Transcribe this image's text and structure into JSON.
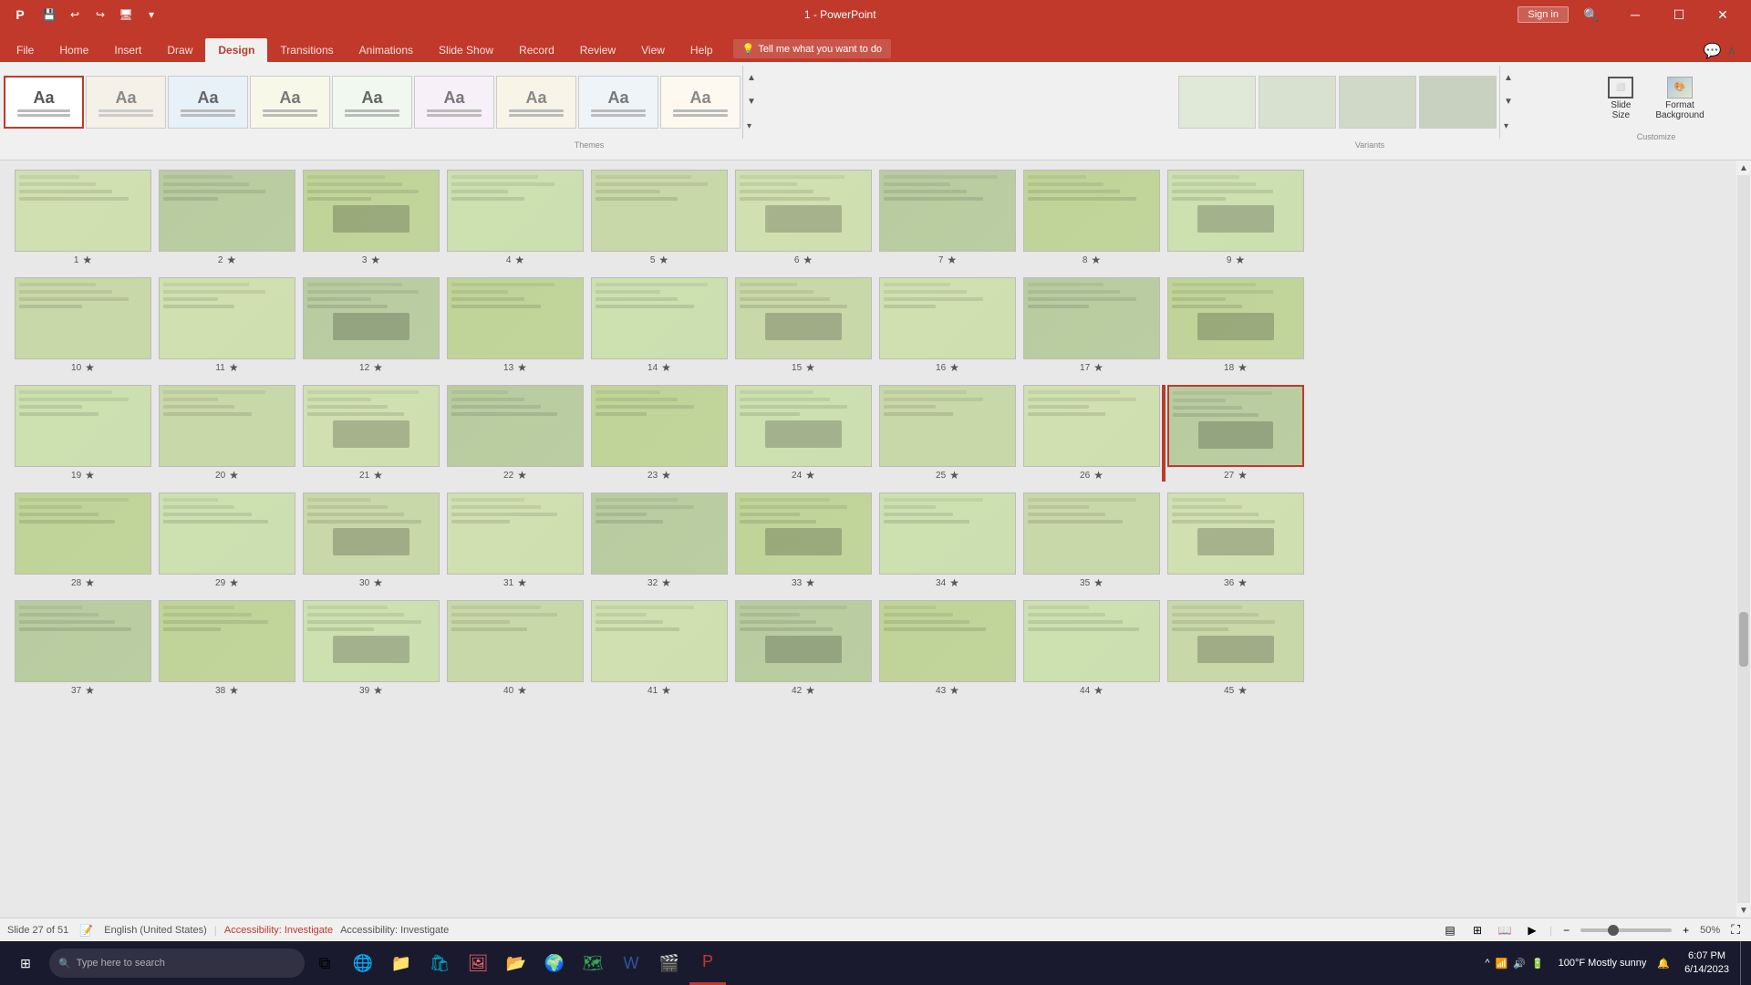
{
  "titleBar": {
    "title": "1 - PowerPoint",
    "signIn": "Sign in",
    "quickAccess": [
      "💾",
      "↩",
      "↪",
      "🖥"
    ]
  },
  "ribbonTabs": {
    "tabs": [
      "File",
      "Home",
      "Insert",
      "Draw",
      "Design",
      "Transitions",
      "Animations",
      "Slide Show",
      "Record",
      "Review",
      "View",
      "Help"
    ],
    "activeTab": "Design",
    "tellMe": "Tell me what you want to do"
  },
  "ribbon": {
    "themesLabel": "Themes",
    "variantsLabel": "Variants",
    "customizeLabel": "Customize",
    "slideSize": "Slide\nSize",
    "formatBackground": "Format\nBackground"
  },
  "slides": [
    {
      "num": 1,
      "star": true
    },
    {
      "num": 2,
      "star": true
    },
    {
      "num": 3,
      "star": true
    },
    {
      "num": 4,
      "star": true
    },
    {
      "num": 5,
      "star": true
    },
    {
      "num": 6,
      "star": true
    },
    {
      "num": 7,
      "star": true
    },
    {
      "num": 8,
      "star": true
    },
    {
      "num": 9,
      "star": true
    },
    {
      "num": 10,
      "star": true
    },
    {
      "num": 11,
      "star": true
    },
    {
      "num": 12,
      "star": true
    },
    {
      "num": 13,
      "star": true
    },
    {
      "num": 14,
      "star": true
    },
    {
      "num": 15,
      "star": true
    },
    {
      "num": 16,
      "star": true
    },
    {
      "num": 17,
      "star": true
    },
    {
      "num": 18,
      "star": true
    },
    {
      "num": 19,
      "star": true
    },
    {
      "num": 20,
      "star": true
    },
    {
      "num": 21,
      "star": true
    },
    {
      "num": 22,
      "star": true
    },
    {
      "num": 23,
      "star": true
    },
    {
      "num": 24,
      "star": true
    },
    {
      "num": 25,
      "star": true
    },
    {
      "num": 26,
      "star": true
    },
    {
      "num": 27,
      "star": true,
      "selected": true
    },
    {
      "num": 28,
      "star": true
    },
    {
      "num": 29,
      "star": true
    },
    {
      "num": 30,
      "star": true
    },
    {
      "num": 31,
      "star": true
    },
    {
      "num": 32,
      "star": true
    },
    {
      "num": 33,
      "star": true
    },
    {
      "num": 34,
      "star": true
    },
    {
      "num": 35,
      "star": true
    },
    {
      "num": 36,
      "star": true
    },
    {
      "num": 37,
      "star": true
    },
    {
      "num": 38,
      "star": true
    },
    {
      "num": 39,
      "star": true
    },
    {
      "num": 40,
      "star": true
    },
    {
      "num": 41,
      "star": true
    },
    {
      "num": 42,
      "star": true
    },
    {
      "num": 43,
      "star": true
    },
    {
      "num": 44,
      "star": true
    },
    {
      "num": 45,
      "star": true
    }
  ],
  "statusBar": {
    "slideInfo": "Slide 27 of 51",
    "language": "English (United States)",
    "accessibility": "Accessibility: Investigate",
    "zoom": "50%"
  },
  "taskbar": {
    "searchPlaceholder": "Type here to search",
    "time": "6:07 PM",
    "date": "6/14/2023",
    "weather": "100°F  Mostly sunny"
  }
}
